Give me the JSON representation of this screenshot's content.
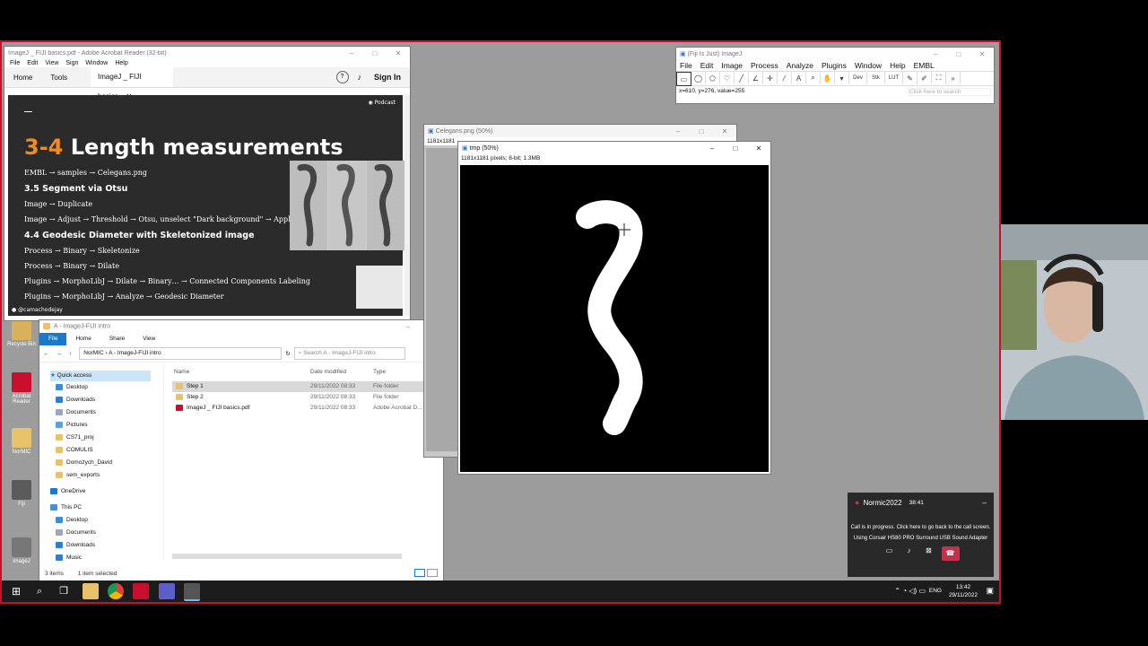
{
  "desktop_icons": [
    {
      "label": "Recycle Bin"
    },
    {
      "label": "Acrobat Reader"
    },
    {
      "label": "NorMIC"
    },
    {
      "label": "Fiji"
    },
    {
      "label": "imageJ"
    }
  ],
  "acrobat": {
    "title": "ImageJ _ FIJI basics.pdf - Adobe Acrobat Reader (32-bit)",
    "menu": [
      "File",
      "Edit",
      "View",
      "Sign",
      "Window",
      "Help"
    ],
    "tabs": {
      "home": "Home",
      "tools": "Tools",
      "doc": "ImageJ _ FIJI basics...",
      "signin": "Sign In"
    },
    "slide": {
      "badge": "Podcast",
      "title_num": "3-4",
      "title_text": "Length measurements",
      "lines": [
        {
          "text": "EMBL → samples → Celegans.png",
          "heading": false
        },
        {
          "text": "3.5 Segment via Otsu",
          "heading": true
        },
        {
          "text": "Image → Duplicate",
          "heading": false
        },
        {
          "text": "Image → Adjust → Threshold → Otsu, unselect \"Dark background\" → Apply",
          "heading": false
        },
        {
          "text": "4.4 Geodesic Diameter with Skeletonized image",
          "heading": true
        },
        {
          "text": "Process → Binary → Skeletonize",
          "heading": false
        },
        {
          "text": "Process → Binary → Dilate",
          "heading": false
        },
        {
          "text": "Plugins → MorphoLibJ → Dilate → Binary… → Connected Components Labeling",
          "heading": false
        },
        {
          "text": "Plugins → MorphoLibJ → Analyze → Geodesic Diameter",
          "heading": false
        }
      ],
      "handle": "@camachodejay"
    }
  },
  "explorer": {
    "title": "A - ImageJ-FIJI intro",
    "ribbon": [
      "File",
      "Home",
      "Share",
      "View"
    ],
    "path": [
      "NorMIC",
      "A - ImageJ-FIJI intro"
    ],
    "search_placeholder": "Search A - ImageJ-FIJI intro",
    "nav": [
      "Quick access",
      "Desktop",
      "Downloads",
      "Documents",
      "Pictures",
      "CS71_proj",
      "COMULIS",
      "Domozych_David",
      "sem_exports",
      "OneDrive",
      "This PC",
      "Desktop",
      "Documents",
      "Downloads",
      "Music"
    ],
    "columns": {
      "name": "Name",
      "date": "Date modified",
      "type": "Type"
    },
    "files": [
      {
        "name": "Step 1",
        "date": "29/11/2022 08:33",
        "type": "File folder"
      },
      {
        "name": "Step 2",
        "date": "29/11/2022 08:33",
        "type": "File folder"
      },
      {
        "name": "ImageJ _ FIJI basics.pdf",
        "date": "29/11/2022 08:33",
        "type": "Adobe Acrobat D..."
      }
    ],
    "status": {
      "count": "3 items",
      "selected": "1 item selected"
    }
  },
  "fiji": {
    "title": "(Fiji Is Just) ImageJ",
    "menu": [
      "File",
      "Edit",
      "Image",
      "Process",
      "Analyze",
      "Plugins",
      "Window",
      "Help",
      "EMBL"
    ],
    "status": "x=610, y=276, value=255",
    "search_placeholder": "Click here to search"
  },
  "celegans": {
    "title": "Celegans.png (50%)",
    "info": "1181x1181"
  },
  "tmp": {
    "title": "tmp (50%)",
    "info": "1181x1181 pixels; 8-bit; 1.3MB"
  },
  "call": {
    "name": "Normic2022",
    "time": "38:41",
    "msg": "Call is in progress. Click here to go back to the call screen.",
    "device": "Using Corsair HS80 PRO Surround USB Sound Adapter"
  },
  "taskbar": {
    "lang": "ENG",
    "time": "13:42",
    "date": "29/11/2022"
  },
  "colors": {
    "accent_red": "#c8102e",
    "slide_orange": "#f28b1e",
    "explorer_blue": "#1979ca",
    "call_end": "#c4314b"
  }
}
